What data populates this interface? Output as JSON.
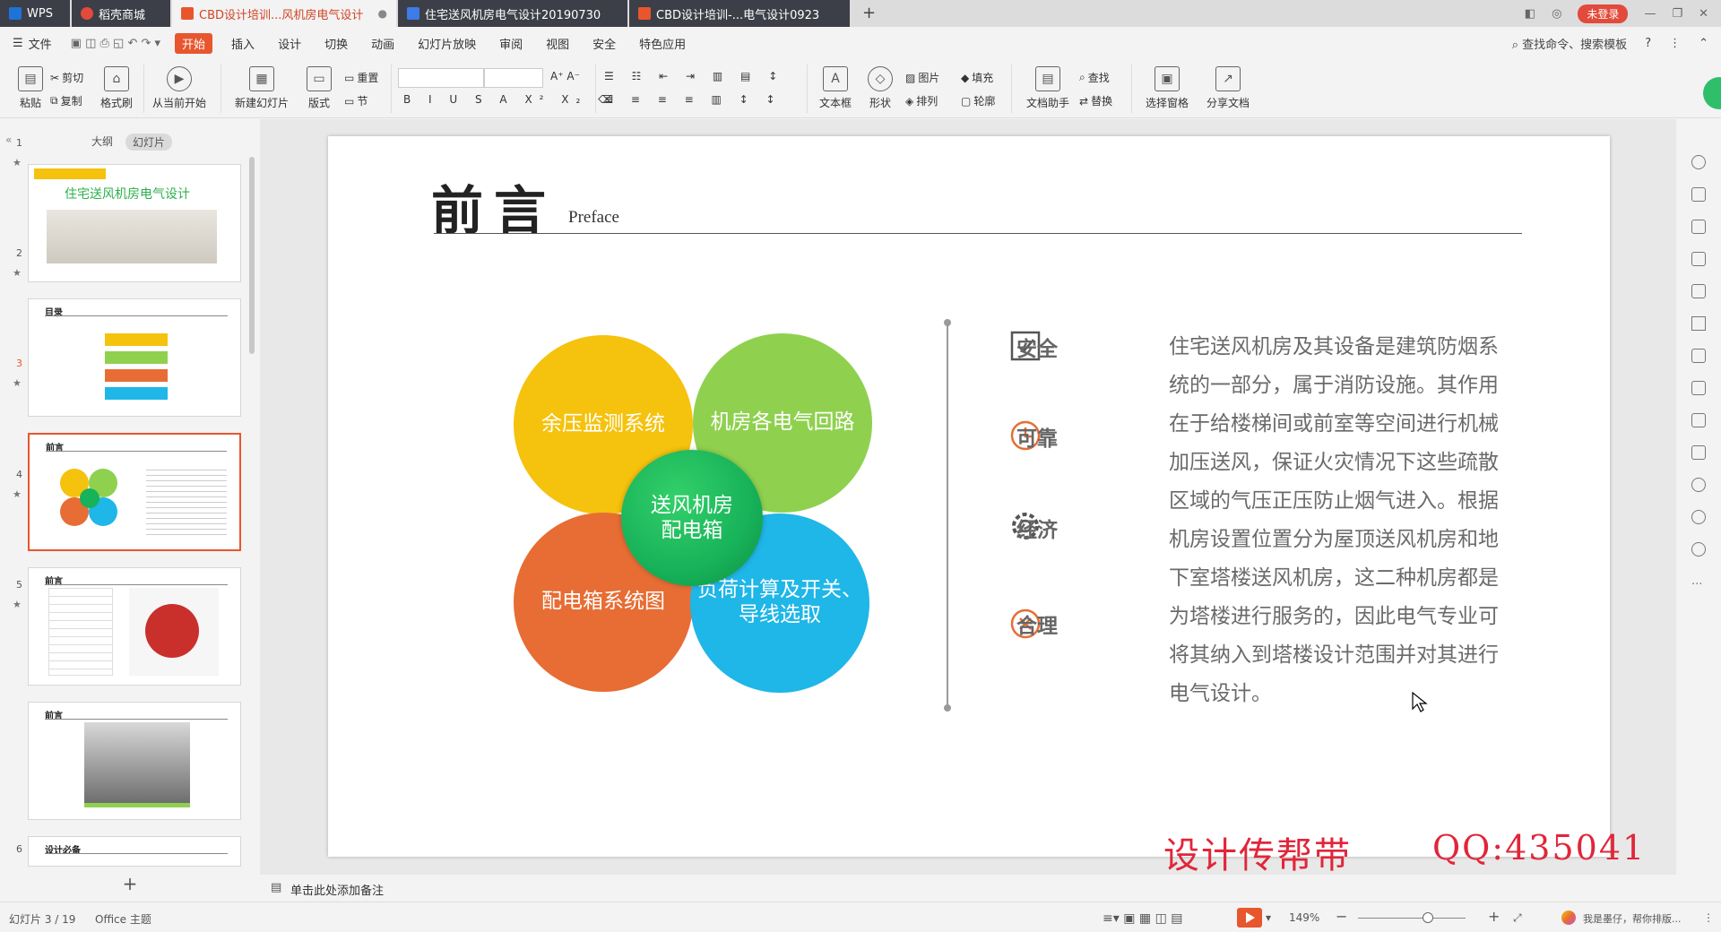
{
  "titlebar": {
    "tabs": [
      {
        "label": "WPS"
      },
      {
        "label": "稻壳商城"
      },
      {
        "label": "CBD设计培训...风机房电气设计"
      },
      {
        "label": "住宅送风机房电气设计20190730"
      },
      {
        "label": "CBD设计培训-...电气设计0923"
      }
    ],
    "new_tab": "+",
    "login": "未登录"
  },
  "menubar": {
    "file": "文件",
    "items": [
      "开始",
      "插入",
      "设计",
      "切换",
      "动画",
      "幻灯片放映",
      "审阅",
      "视图",
      "安全",
      "特色应用"
    ],
    "search": "查找命令、搜索模板",
    "help": "?"
  },
  "ribbon": {
    "paste": "粘贴",
    "cut": "剪切",
    "copy": "复制",
    "format_painter": "格式刷",
    "from_current": "从当前开始",
    "new_slide": "新建幻灯片",
    "layout": "版式",
    "reset": "重置",
    "section": "节",
    "textbox": "文本框",
    "shape": "形状",
    "picture": "图片",
    "arrange": "排列",
    "fill": "填充",
    "outline": "轮廓",
    "doc_assistant": "文档助手",
    "find": "查找",
    "replace": "替换",
    "selection_pane": "选择窗格",
    "share": "分享文档"
  },
  "side": {
    "outline_tab": "大纲",
    "slides_tab": "幻灯片",
    "thumbs": [
      {
        "num": "1",
        "title": "住宅送风机房电气设计"
      },
      {
        "num": "2",
        "title": "目录"
      },
      {
        "num": "3",
        "title": "前言"
      },
      {
        "num": "4",
        "title": "前言"
      },
      {
        "num": "5",
        "title": "前言"
      },
      {
        "num": "6",
        "title": "设计必备"
      }
    ],
    "add": "+"
  },
  "slide": {
    "title": "前言",
    "subtitle": "Preface",
    "circles": {
      "top_left": "余压监测系统",
      "top_right": "机房各电气回路",
      "bottom_left": "配电箱系统图",
      "bottom_right": "负荷计算及开关、导线选取",
      "center": "送风机房配电箱"
    },
    "features": [
      "安全",
      "可靠",
      "经济",
      "合理"
    ],
    "paragraph": "住宅送风机房及其设备是建筑防烟系统的一部分，属于消防设施。其作用在于给楼梯间或前室等空间进行机械加压送风，保证火灾情况下这些疏散区域的气压正压防止烟气进入。根据机房设置位置分为屋顶送风机房和地下室塔楼送风机房，这二种机房都是为塔楼进行服务的，因此电气专业可将其纳入到塔楼设计范围并对其进行电气设计。",
    "watermark_left": "设计传帮带",
    "watermark_right": "QQ:435041"
  },
  "notes": {
    "placeholder": "单击此处添加备注"
  },
  "status": {
    "slide_count": "幻灯片 3 / 19",
    "theme": "Office 主题",
    "zoom": "149%",
    "user_text": "我是墨仔，帮你排版..."
  },
  "colors": {
    "accent": "#e8562e",
    "yellow": "#f5c20e",
    "green": "#8fd14f",
    "orange": "#e76d34",
    "blue": "#1fb6e8",
    "center_green": "#17b259",
    "watermark": "#e1263a"
  }
}
